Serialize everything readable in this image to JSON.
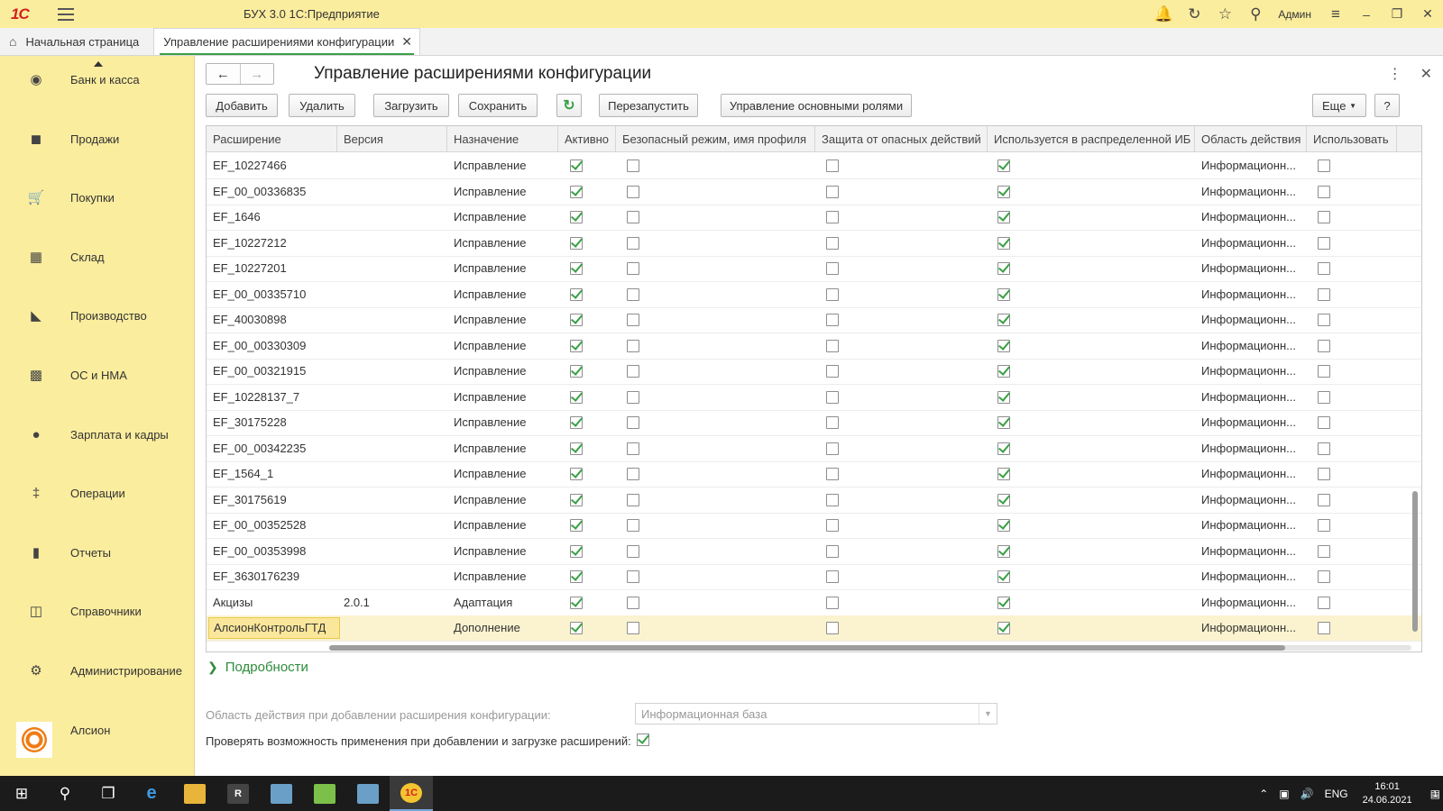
{
  "titlebar": {
    "logo": "1С",
    "title": "БУХ 3.0 1С:Предприятие",
    "user": "Админ"
  },
  "tabs": {
    "home": "Начальная страница",
    "active": "Управление расширениями конфигурации"
  },
  "sidebar": {
    "items": [
      {
        "label": "Банк и касса",
        "icon": "bank-icon"
      },
      {
        "label": "Продажи",
        "icon": "sales-bag-icon"
      },
      {
        "label": "Покупки",
        "icon": "cart-icon"
      },
      {
        "label": "Склад",
        "icon": "warehouse-grid-icon"
      },
      {
        "label": "Производство",
        "icon": "factory-icon"
      },
      {
        "label": "ОС и НМА",
        "icon": "truck-icon"
      },
      {
        "label": "Зарплата и кадры",
        "icon": "person-icon"
      },
      {
        "label": "Операции",
        "icon": "dt-kt-icon"
      },
      {
        "label": "Отчеты",
        "icon": "bar-chart-icon"
      },
      {
        "label": "Справочники",
        "icon": "books-icon"
      },
      {
        "label": "Администрирование",
        "icon": "gear-icon"
      },
      {
        "label": "Алсион",
        "icon": "alsion-sun-icon"
      }
    ]
  },
  "page": {
    "title": "Управление расширениями конфигурации"
  },
  "toolbar": {
    "add": "Добавить",
    "delete": "Удалить",
    "load": "Загрузить",
    "save": "Сохранить",
    "restart": "Перезапустить",
    "roles": "Управление основными ролями",
    "more": "Еще",
    "help": "?"
  },
  "table": {
    "columns": [
      "Расширение",
      "Версия",
      "Назначение",
      "Активно",
      "Безопасный режим, имя профиля",
      "Защита от опасных действий",
      "Используется в распределенной ИБ",
      "Область действия",
      "Использовать"
    ],
    "rows": [
      {
        "name": "EF_10227466",
        "version": "",
        "purpose": "Исправление",
        "active": true,
        "safe": false,
        "protect": false,
        "distributed": true,
        "scope": "Информационн...",
        "use": false
      },
      {
        "name": "EF_00_00336835",
        "version": "",
        "purpose": "Исправление",
        "active": true,
        "safe": false,
        "protect": false,
        "distributed": true,
        "scope": "Информационн...",
        "use": false
      },
      {
        "name": "EF_1646",
        "version": "",
        "purpose": "Исправление",
        "active": true,
        "safe": false,
        "protect": false,
        "distributed": true,
        "scope": "Информационн...",
        "use": false
      },
      {
        "name": "EF_10227212",
        "version": "",
        "purpose": "Исправление",
        "active": true,
        "safe": false,
        "protect": false,
        "distributed": true,
        "scope": "Информационн...",
        "use": false
      },
      {
        "name": "EF_10227201",
        "version": "",
        "purpose": "Исправление",
        "active": true,
        "safe": false,
        "protect": false,
        "distributed": true,
        "scope": "Информационн...",
        "use": false
      },
      {
        "name": "EF_00_00335710",
        "version": "",
        "purpose": "Исправление",
        "active": true,
        "safe": false,
        "protect": false,
        "distributed": true,
        "scope": "Информационн...",
        "use": false
      },
      {
        "name": "EF_40030898",
        "version": "",
        "purpose": "Исправление",
        "active": true,
        "safe": false,
        "protect": false,
        "distributed": true,
        "scope": "Информационн...",
        "use": false
      },
      {
        "name": "EF_00_00330309",
        "version": "",
        "purpose": "Исправление",
        "active": true,
        "safe": false,
        "protect": false,
        "distributed": true,
        "scope": "Информационн...",
        "use": false
      },
      {
        "name": "EF_00_00321915",
        "version": "",
        "purpose": "Исправление",
        "active": true,
        "safe": false,
        "protect": false,
        "distributed": true,
        "scope": "Информационн...",
        "use": false
      },
      {
        "name": "EF_10228137_7",
        "version": "",
        "purpose": "Исправление",
        "active": true,
        "safe": false,
        "protect": false,
        "distributed": true,
        "scope": "Информационн...",
        "use": false
      },
      {
        "name": "EF_30175228",
        "version": "",
        "purpose": "Исправление",
        "active": true,
        "safe": false,
        "protect": false,
        "distributed": true,
        "scope": "Информационн...",
        "use": false
      },
      {
        "name": "EF_00_00342235",
        "version": "",
        "purpose": "Исправление",
        "active": true,
        "safe": false,
        "protect": false,
        "distributed": true,
        "scope": "Информационн...",
        "use": false
      },
      {
        "name": "EF_1564_1",
        "version": "",
        "purpose": "Исправление",
        "active": true,
        "safe": false,
        "protect": false,
        "distributed": true,
        "scope": "Информационн...",
        "use": false
      },
      {
        "name": "EF_30175619",
        "version": "",
        "purpose": "Исправление",
        "active": true,
        "safe": false,
        "protect": false,
        "distributed": true,
        "scope": "Информационн...",
        "use": false
      },
      {
        "name": "EF_00_00352528",
        "version": "",
        "purpose": "Исправление",
        "active": true,
        "safe": false,
        "protect": false,
        "distributed": true,
        "scope": "Информационн...",
        "use": false
      },
      {
        "name": "EF_00_00353998",
        "version": "",
        "purpose": "Исправление",
        "active": true,
        "safe": false,
        "protect": false,
        "distributed": true,
        "scope": "Информационн...",
        "use": false
      },
      {
        "name": "EF_3630176239",
        "version": "",
        "purpose": "Исправление",
        "active": true,
        "safe": false,
        "protect": false,
        "distributed": true,
        "scope": "Информационн...",
        "use": false
      },
      {
        "name": "Акцизы",
        "version": "2.0.1",
        "purpose": "Адаптация",
        "active": true,
        "safe": false,
        "protect": false,
        "distributed": true,
        "scope": "Информационн...",
        "use": false
      },
      {
        "name": "АлсионКонтрольГТД",
        "version": "",
        "purpose": "Дополнение",
        "active": true,
        "safe": false,
        "protect": false,
        "distributed": true,
        "scope": "Информационн...",
        "use": false,
        "selected": true
      }
    ]
  },
  "details": {
    "label": "Подробности"
  },
  "settings": {
    "scope_label": "Область действия при добавлении расширения конфигурации:",
    "scope_value": "Информационная база",
    "check_label": "Проверять возможность применения при добавлении и загрузке расширений:",
    "check_value": true
  },
  "taskbar": {
    "lang": "ENG",
    "time": "16:01",
    "date": "24.06.2021",
    "notifications": "1"
  }
}
